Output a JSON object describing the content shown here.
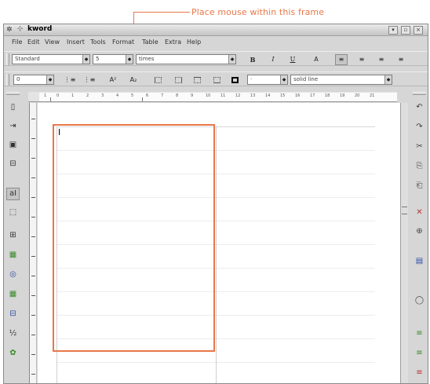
{
  "annotation": {
    "text": "Place mouse within this frame"
  },
  "window": {
    "title": "kword",
    "sys_icon": "kde-icon",
    "pin_icon": "pin-icon",
    "controls": [
      "▾",
      "▫",
      "×"
    ]
  },
  "menu": [
    "File",
    "Edit",
    "View",
    "Insert",
    "Tools",
    "Format",
    "Table",
    "Extra",
    "Help"
  ],
  "format_toolbar": {
    "style": "Standard",
    "size": "5",
    "font": "times",
    "bold": "B",
    "italic": "I",
    "underline": "U",
    "char_color": "A",
    "align_left": "≡",
    "align_center": "≡",
    "align_right": "≡",
    "align_justify": "≡"
  },
  "frame_toolbar": {
    "border_width": "0",
    "list_bullets": "⋮≡",
    "list_numbers": "⋮≡",
    "superscript": "A²",
    "subscript": "A₂",
    "border_style": "solid line",
    "border_color": "·"
  },
  "ruler": {
    "labels": [
      "1",
      "0",
      "1",
      "2",
      "3",
      "4",
      "5",
      "6",
      "7",
      "8",
      "9",
      "10",
      "11",
      "12",
      "13",
      "14",
      "15",
      "16",
      "17",
      "18",
      "19",
      "20",
      "21"
    ]
  },
  "left_tools": [
    "▯",
    "⇥",
    "▣",
    "⊟",
    "aI",
    "⬚",
    "⊞",
    "▦",
    "◎",
    "▦",
    "⊟",
    "½",
    "✿"
  ],
  "right_tools": [
    "↶",
    "↷",
    "✂",
    "⎘",
    "⎗",
    "✕",
    "⊕",
    "▤",
    "◯",
    "≡",
    "≡",
    "≡"
  ]
}
